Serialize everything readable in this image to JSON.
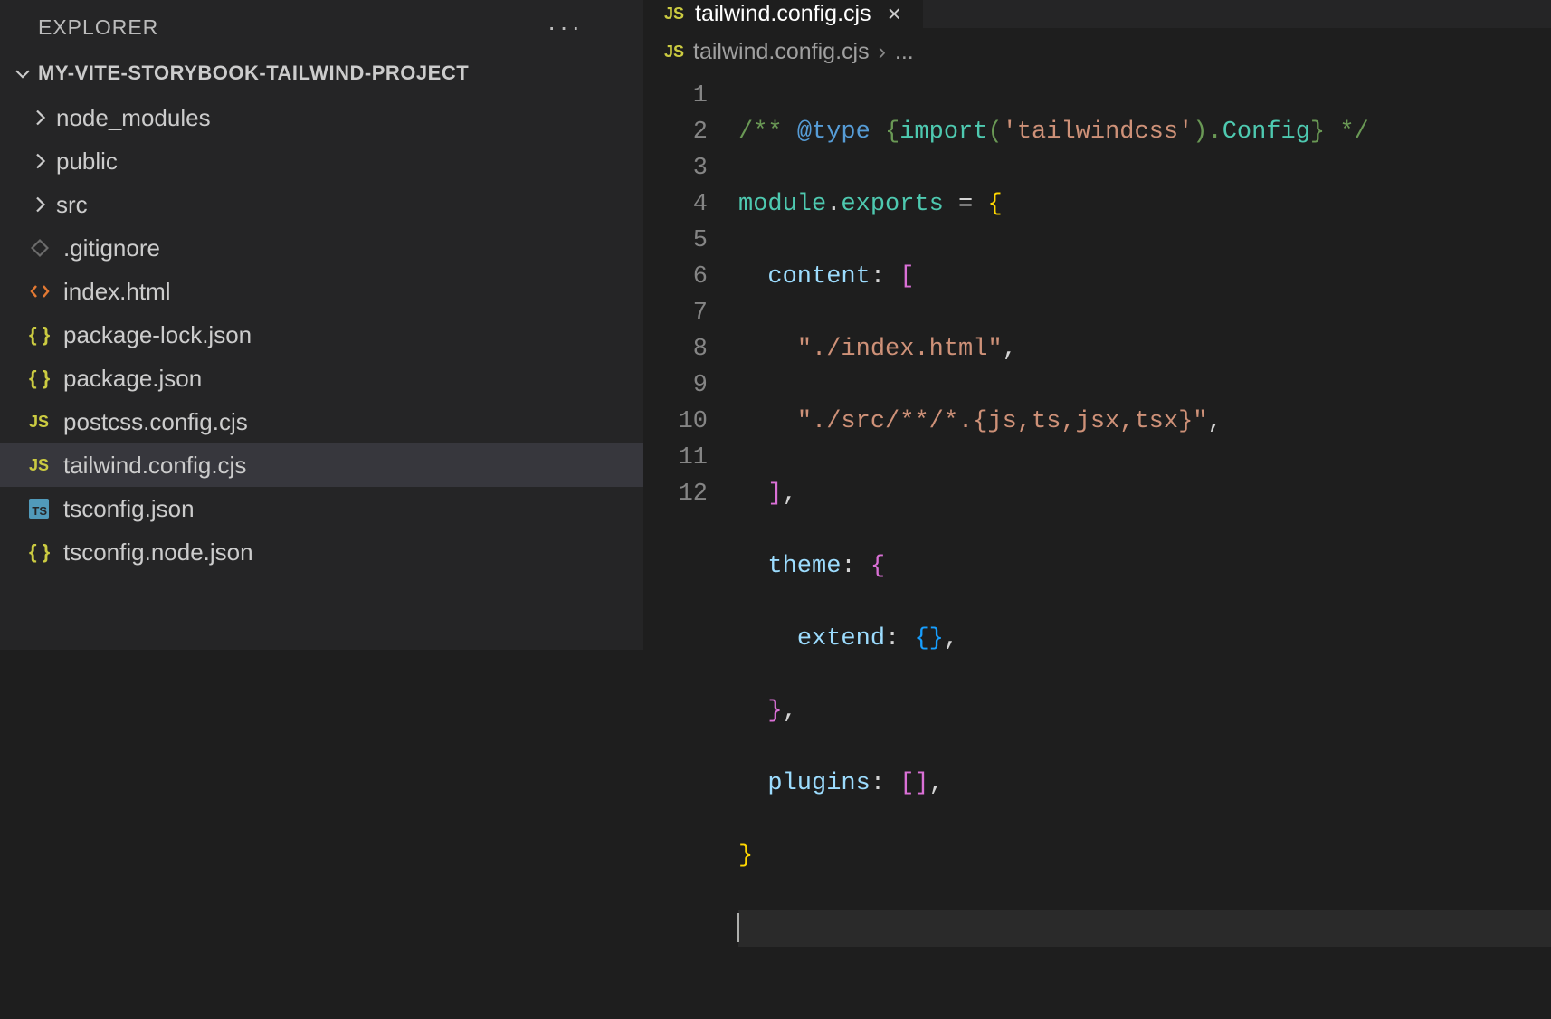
{
  "sidebar": {
    "title": "EXPLORER",
    "project": "MY-VITE-STORYBOOK-TAILWIND-PROJECT",
    "items": [
      {
        "label": "node_modules",
        "type": "folder"
      },
      {
        "label": "public",
        "type": "folder"
      },
      {
        "label": "src",
        "type": "folder"
      },
      {
        "label": ".gitignore",
        "type": "git"
      },
      {
        "label": "index.html",
        "type": "html"
      },
      {
        "label": "package-lock.json",
        "type": "json"
      },
      {
        "label": "package.json",
        "type": "json"
      },
      {
        "label": "postcss.config.cjs",
        "type": "js"
      },
      {
        "label": "tailwind.config.cjs",
        "type": "js",
        "selected": true
      },
      {
        "label": "tsconfig.json",
        "type": "ts"
      },
      {
        "label": "tsconfig.node.json",
        "type": "json"
      }
    ]
  },
  "editor": {
    "tab": {
      "label": "tailwind.config.cjs",
      "icon": "JS"
    },
    "breadcrumb": {
      "icon": "JS",
      "file": "tailwind.config.cjs",
      "rest": "..."
    },
    "lines": [
      1,
      2,
      3,
      4,
      5,
      6,
      7,
      8,
      9,
      10,
      11,
      12
    ],
    "code": {
      "l1_a": "/** ",
      "l1_b": "@type",
      "l1_c": " {",
      "l1_d": "import",
      "l1_e": "(",
      "l1_f": "'tailwindcss'",
      "l1_g": ").",
      "l1_h": "Config",
      "l1_i": "} */",
      "l2_a": "module",
      "l2_b": ".",
      "l2_c": "exports",
      "l2_d": " = ",
      "l2_e": "{",
      "l3_a": "content",
      "l3_b": ": ",
      "l3_c": "[",
      "l4_a": "\"./index.html\"",
      "l4_b": ",",
      "l5_a": "\"./src/**/*.{js,ts,jsx,tsx}\"",
      "l5_b": ",",
      "l6_a": "]",
      "l6_b": ",",
      "l7_a": "theme",
      "l7_b": ": ",
      "l7_c": "{",
      "l8_a": "extend",
      "l8_b": ": ",
      "l8_c": "{}",
      "l8_d": ",",
      "l9_a": "}",
      "l9_b": ",",
      "l10_a": "plugins",
      "l10_b": ": ",
      "l10_c": "[]",
      "l10_d": ",",
      "l11_a": "}"
    }
  }
}
